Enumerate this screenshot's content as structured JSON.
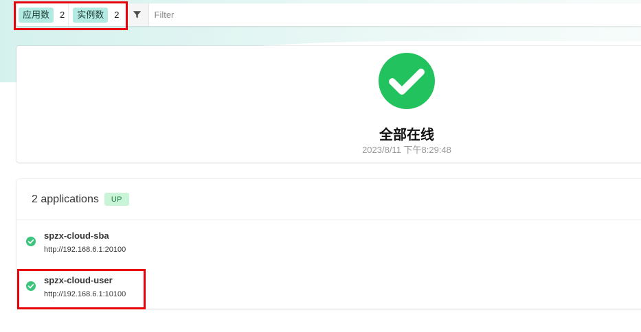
{
  "toolbar": {
    "app_count_label": "应用数",
    "app_count": "2",
    "instance_count_label": "实例数",
    "instance_count": "2",
    "filter_placeholder": "Filter"
  },
  "status": {
    "title": "全部在线",
    "timestamp": "2023/8/11 下午8:29:48",
    "icon": "check-circle-icon",
    "color": "#22c35e"
  },
  "applications": {
    "title": "2 applications",
    "status_badge": "UP",
    "items": [
      {
        "name": "spzx-cloud-sba",
        "url": "http://192.168.6.1:20100",
        "status_icon": "check-circle-icon"
      },
      {
        "name": "spzx-cloud-user",
        "url": "http://192.168.6.1:10100",
        "status_icon": "check-circle-icon"
      }
    ]
  },
  "colors": {
    "accent_tag": "#b3ebe3",
    "up_badge": "#c9f4d7",
    "success": "#22c35e",
    "highlight": "#e8000b"
  }
}
